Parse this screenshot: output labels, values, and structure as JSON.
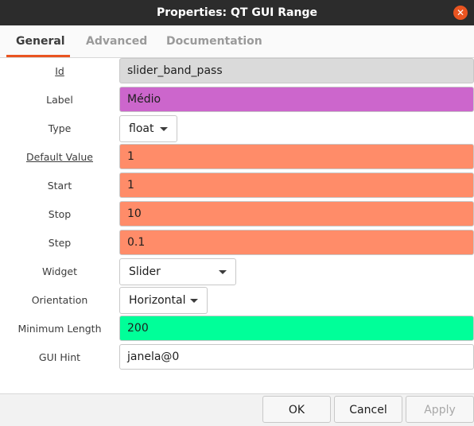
{
  "window": {
    "title": "Properties: QT GUI Range"
  },
  "tabs": [
    {
      "label": "General",
      "active": true
    },
    {
      "label": "Advanced",
      "active": false
    },
    {
      "label": "Documentation",
      "active": false
    }
  ],
  "fields": {
    "id": {
      "label": "Id",
      "value": "slider_band_pass"
    },
    "label": {
      "label": "Label",
      "value": "Médio"
    },
    "type": {
      "label": "Type",
      "value": "float"
    },
    "default_value": {
      "label": "Default Value",
      "value": "1"
    },
    "start": {
      "label": "Start",
      "value": "1"
    },
    "stop": {
      "label": "Stop",
      "value": "10"
    },
    "step": {
      "label": "Step",
      "value": "0.1"
    },
    "widget": {
      "label": "Widget",
      "value": "Slider"
    },
    "orientation": {
      "label": "Orientation",
      "value": "Horizontal"
    },
    "minimum_length": {
      "label": "Minimum Length",
      "value": "200"
    },
    "gui_hint": {
      "label": "GUI Hint",
      "value": "janela@0"
    }
  },
  "buttons": {
    "ok": "OK",
    "cancel": "Cancel",
    "apply": "Apply"
  },
  "colors": {
    "titlebar": "#2c2c2c",
    "accent": "#e95420",
    "id_field": "#dadada",
    "label_field": "#cc66cc",
    "float_field": "#ff8c69",
    "int_field": "#00ff99",
    "string_field": "#ffffff"
  },
  "icons": {
    "close": "close-icon",
    "dropdown": "chevron-down-icon"
  }
}
